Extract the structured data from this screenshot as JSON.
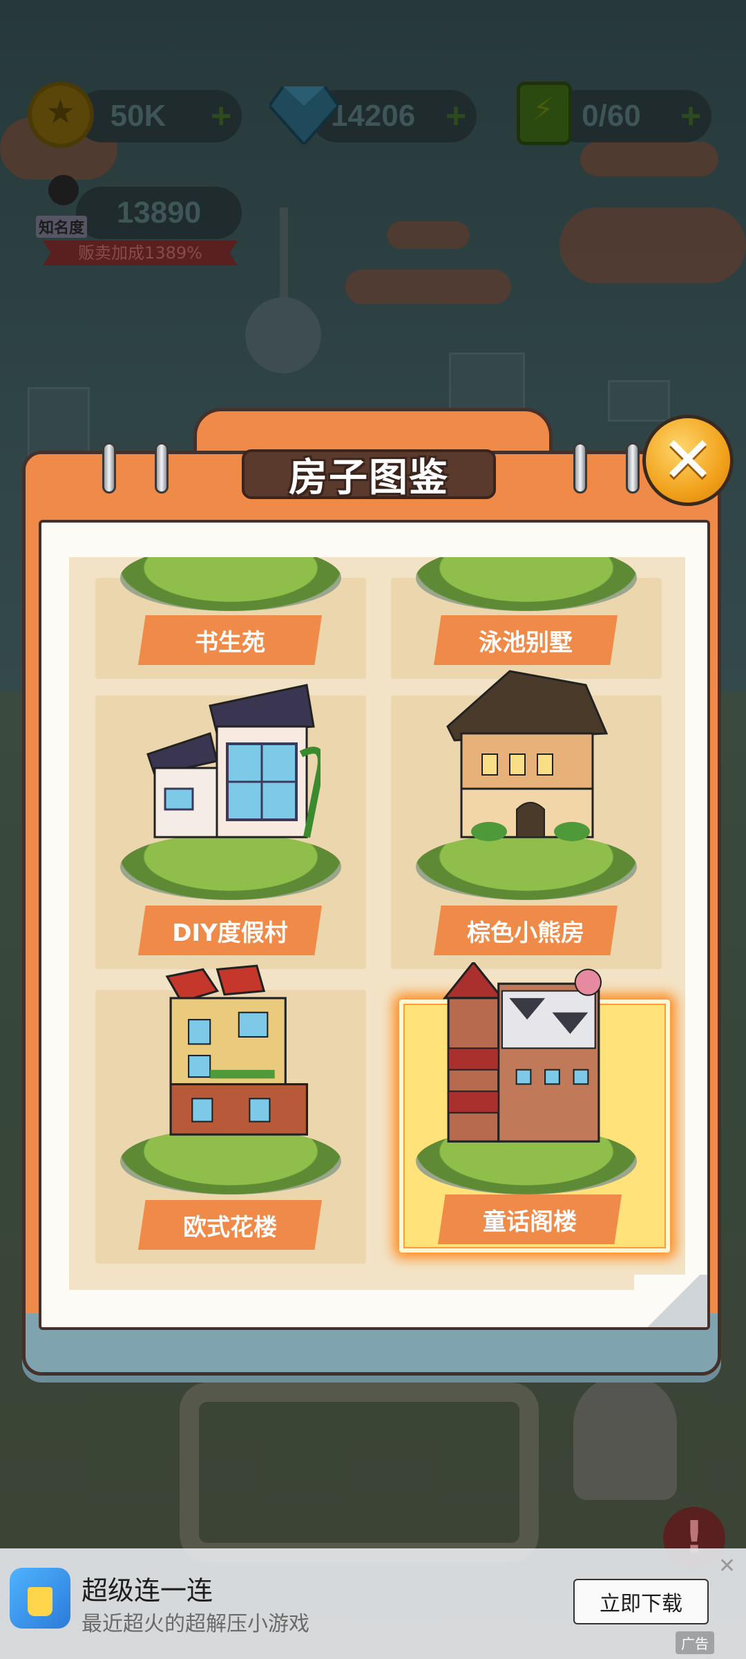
{
  "hud": {
    "coins": "50K",
    "gems": "14206",
    "energy": "0/60",
    "fame": "13890",
    "fame_label": "知名度",
    "bonus_text": "贩卖加成1389%",
    "plus_symbol": "+"
  },
  "modal": {
    "title": "房子图鉴",
    "close_symbol": "✕",
    "houses": [
      {
        "name": "书生苑",
        "selected": false
      },
      {
        "name": "泳池别墅",
        "selected": false
      },
      {
        "name": "DIY度假村",
        "selected": false
      },
      {
        "name": "棕色小熊房",
        "selected": false
      },
      {
        "name": "欧式花楼",
        "selected": false
      },
      {
        "name": "童话阁楼",
        "selected": true
      }
    ]
  },
  "ad": {
    "title": "超级连一连",
    "subtitle": "最近超火的超解压小游戏",
    "cta": "立即下载",
    "close_symbol": "✕",
    "mark": "广告"
  },
  "colors": {
    "accent_orange": "#f08a48",
    "selected_glow": "#ff8a1e",
    "frame_dark": "#45302a"
  }
}
